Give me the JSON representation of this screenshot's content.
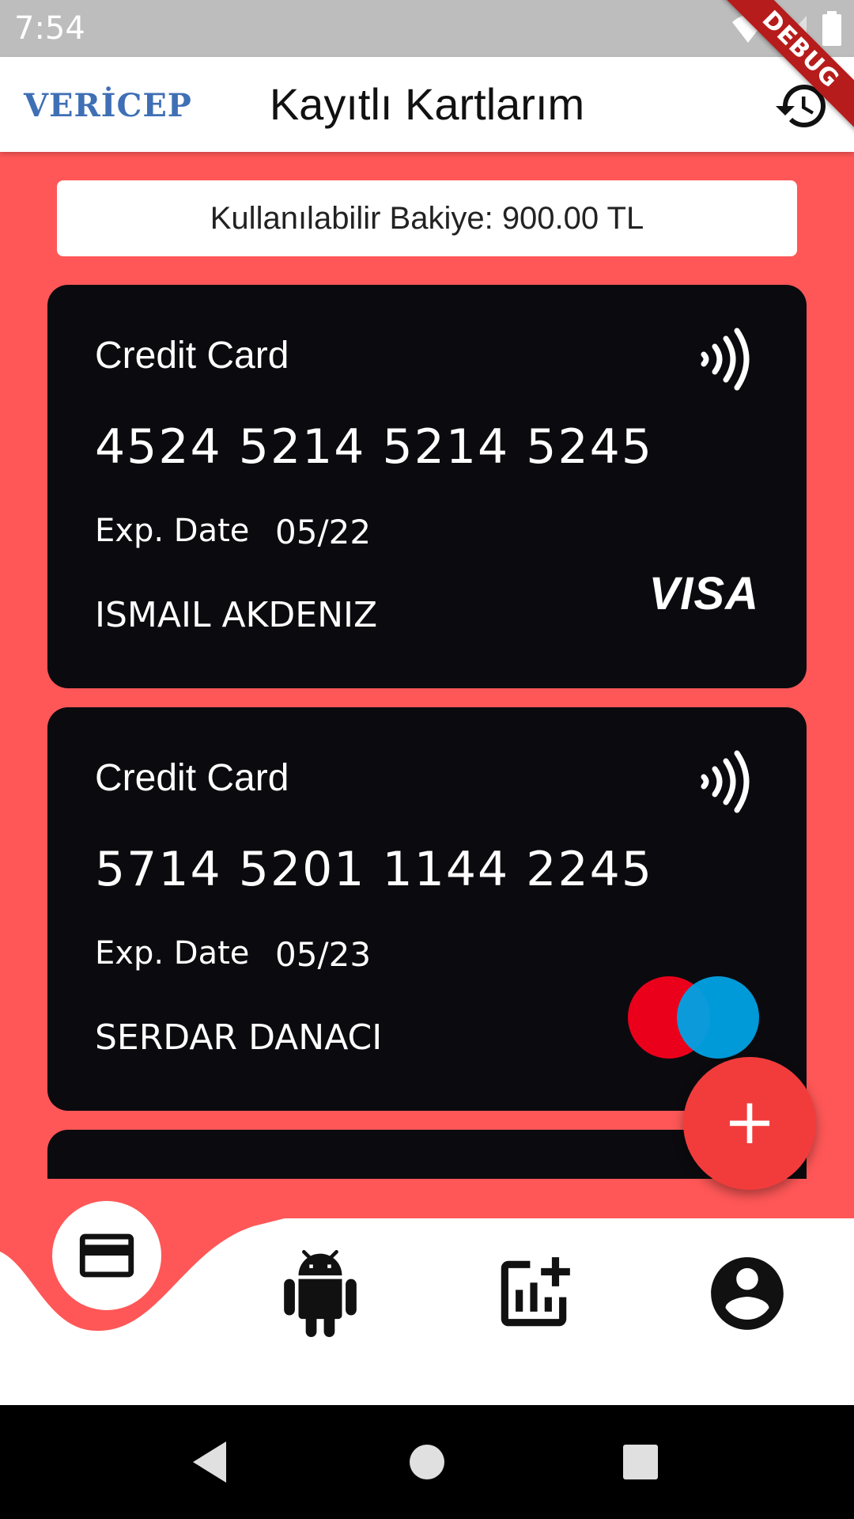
{
  "status_bar": {
    "time": "7:54",
    "debug_label": "DEBUG"
  },
  "app_bar": {
    "logo_text": "VERİCEP",
    "title": "Kayıtlı Kartlarım",
    "history_icon": "history-icon"
  },
  "balance": {
    "text": "Kullanılabilir Bakiye: 900.00 TL"
  },
  "cards": [
    {
      "type": "Credit Card",
      "number": "4524 5214 5214 5245",
      "exp_label": "Exp. Date",
      "exp_value": "05/22",
      "holder": "ISMAIL AKDENIZ",
      "brand": "VISA"
    },
    {
      "type": "Credit Card",
      "number": "5714 5201 1144 2245",
      "exp_label": "Exp. Date",
      "exp_value": "05/23",
      "holder": "SERDAR DANACI",
      "brand": "maestro"
    }
  ],
  "fab": {
    "label": "+"
  },
  "bottom_nav": {
    "items": [
      "credit-card-icon",
      "android-icon",
      "add-chart-icon",
      "account-circle-icon"
    ],
    "selected_index": 0
  },
  "colors": {
    "background": "#FF5757",
    "card": "#0B0B0F",
    "fab": "#F23C3C",
    "logo": "#3F6FB5"
  }
}
